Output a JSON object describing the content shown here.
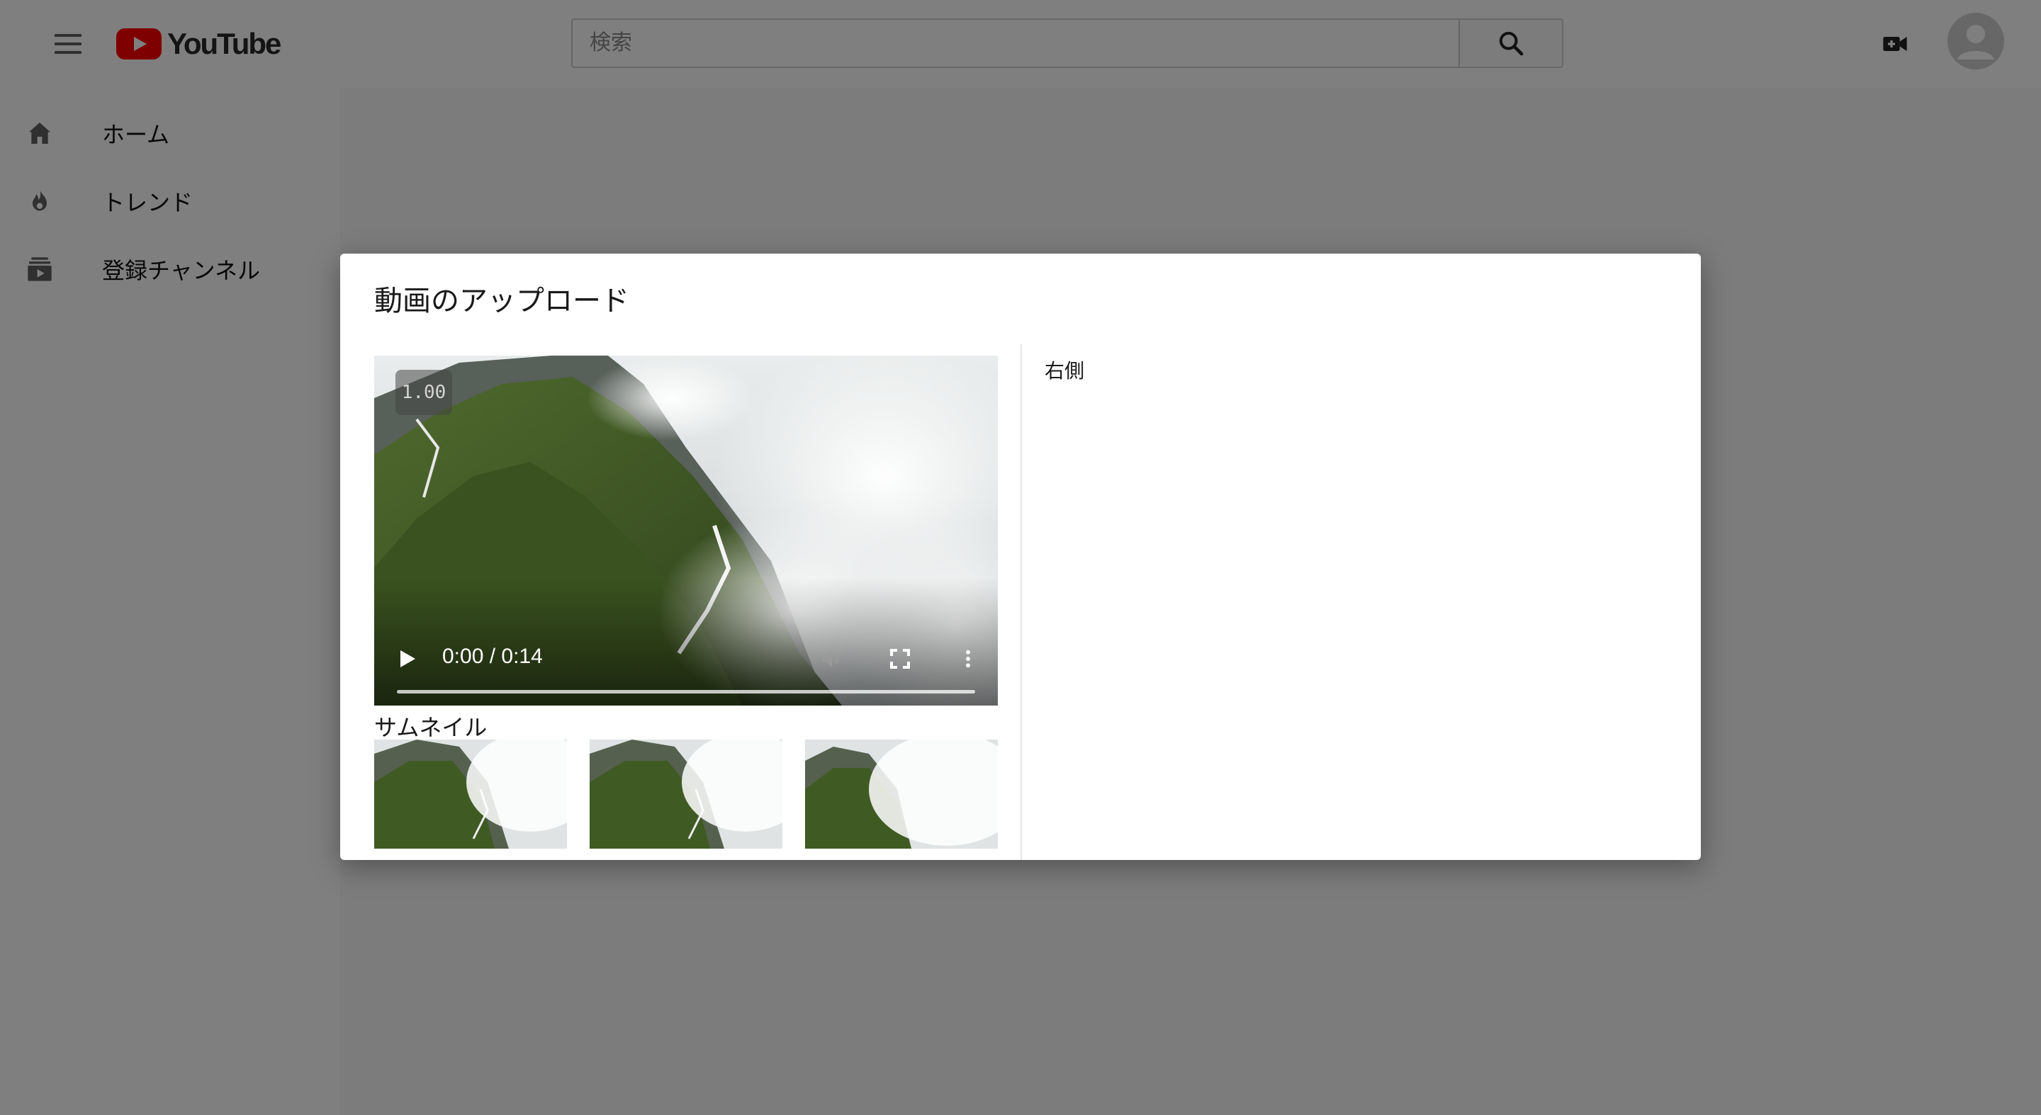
{
  "app": {
    "logo_text": "YouTube",
    "brand_color": "#ff0000"
  },
  "header": {
    "search": {
      "placeholder": "検索",
      "value": ""
    }
  },
  "sidebar": {
    "items": [
      {
        "label": "ホーム",
        "icon": "home-icon"
      },
      {
        "label": "トレンド",
        "icon": "flame-icon"
      },
      {
        "label": "登録チャンネル",
        "icon": "subscriptions-icon"
      }
    ]
  },
  "modal": {
    "title": "動画のアップロード",
    "right_text": "右側",
    "video": {
      "playback_speed": "1.00",
      "time": "0:00 / 0:14"
    },
    "thumbnails_label": "サムネイル"
  }
}
